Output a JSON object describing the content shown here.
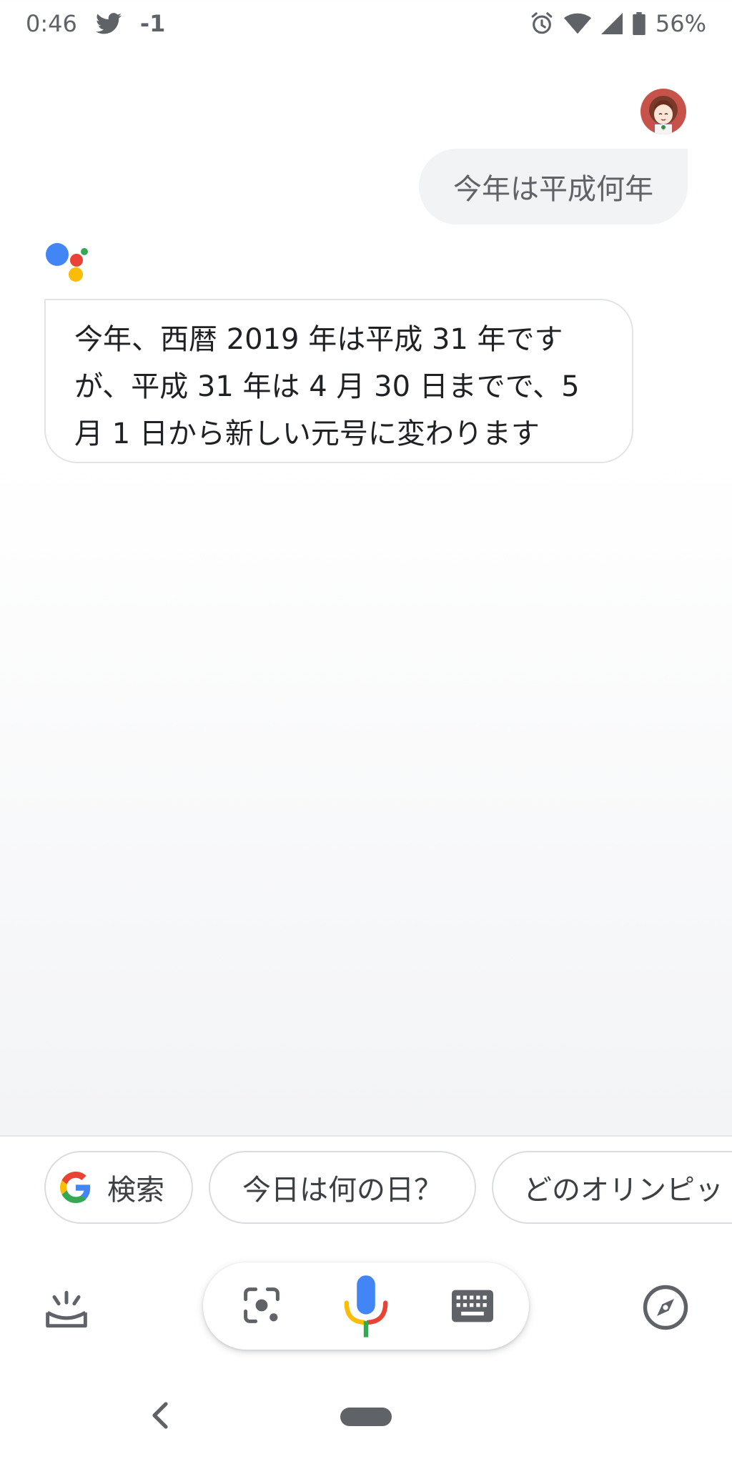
{
  "status_bar": {
    "time": "0:46",
    "notification": "-1",
    "battery": "56%",
    "icons": [
      "twitter-icon",
      "alarm-icon",
      "wifi-icon",
      "signal-icon",
      "battery-icon"
    ]
  },
  "conversation": {
    "user_query": "今年は平成何年",
    "assistant_lines": [
      "今年、西暦 2019 年は平成 31 年です",
      "が、平成 31 年は 4 月 30 日までで、5",
      "月 1 日から新しい元号に変わります"
    ]
  },
  "suggestions": [
    {
      "label": "検索",
      "icon": "google-g-icon"
    },
    {
      "label": "今日は何の日？"
    },
    {
      "label": "どのオリンピッ"
    }
  ],
  "bottom_bar": {
    "icons": [
      "updates-icon",
      "lens-icon",
      "mic-icon",
      "keyboard-icon",
      "explore-compass-icon"
    ]
  },
  "nav": {
    "icons": [
      "back-icon",
      "home-pill"
    ]
  },
  "colors": {
    "google_blue": "#4285F4",
    "google_red": "#EA4335",
    "google_yellow": "#FBBC05",
    "google_green": "#34A853",
    "user_bubble": "#f1f3f4",
    "icon_gray": "#5f6368"
  }
}
